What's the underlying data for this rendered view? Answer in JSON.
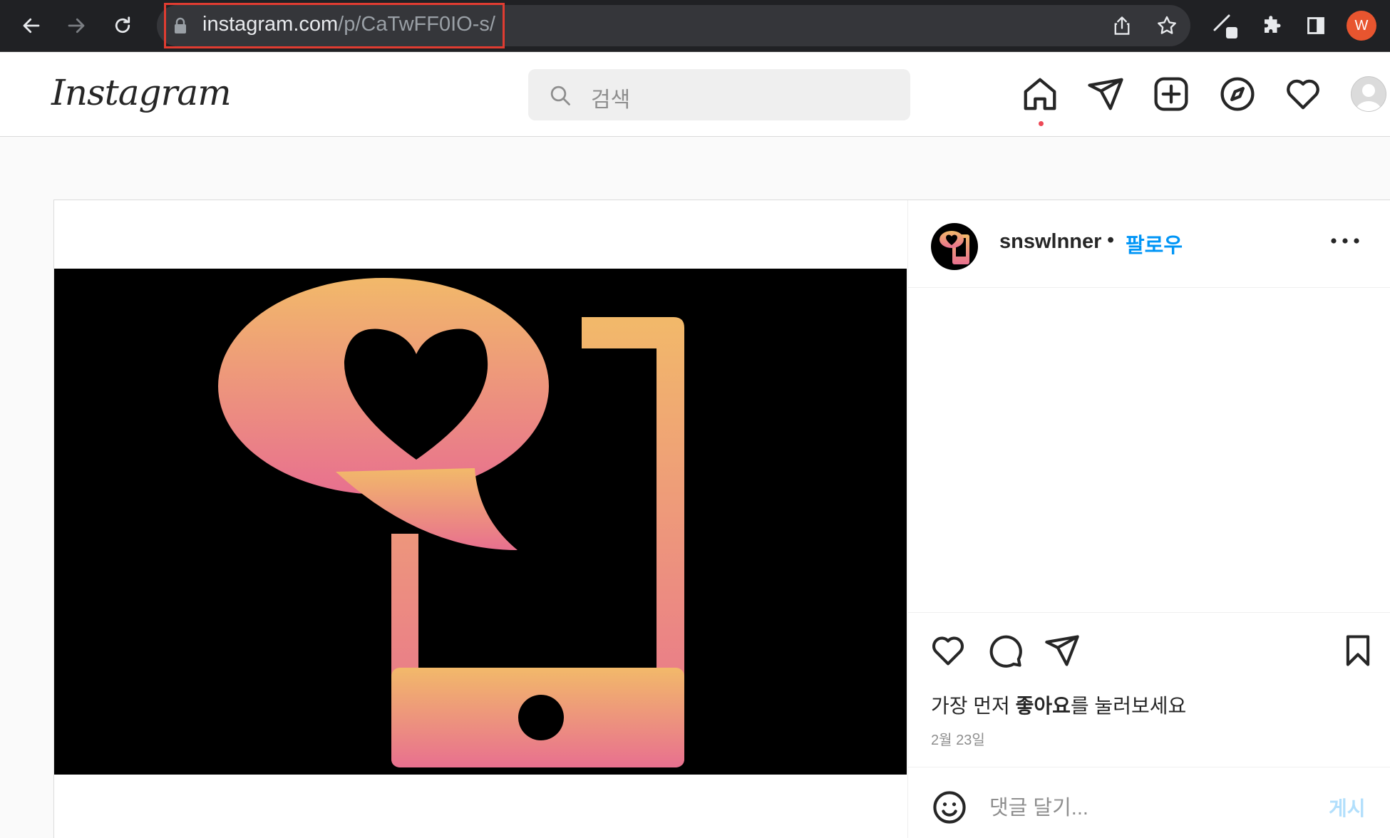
{
  "browser": {
    "url_host": "instagram.com",
    "url_path": "/p/CaTwFF0IO-s/",
    "profile_initial": "W",
    "colors": {
      "bar": "#202124",
      "omnibox": "#35363a",
      "highlight": "#e03c31",
      "profile": "#e8552f"
    }
  },
  "header": {
    "logo": "Instagram",
    "search_placeholder": "검색",
    "notification_dot_color": "#ed4956"
  },
  "post": {
    "username": "snswlnner",
    "separator": "•",
    "follow_label": "팔로우",
    "likes_prefix": "가장 먼저 ",
    "likes_bold": "좋아요",
    "likes_suffix": "를 눌러보세요",
    "date": "2월 23일",
    "comment_placeholder": "댓글 달기...",
    "post_button": "게시",
    "colors": {
      "follow": "#0095f6",
      "post_button_disabled": "#b2dffc",
      "gradient_top": "#f2b96a",
      "gradient_bottom": "#e8708f"
    }
  }
}
